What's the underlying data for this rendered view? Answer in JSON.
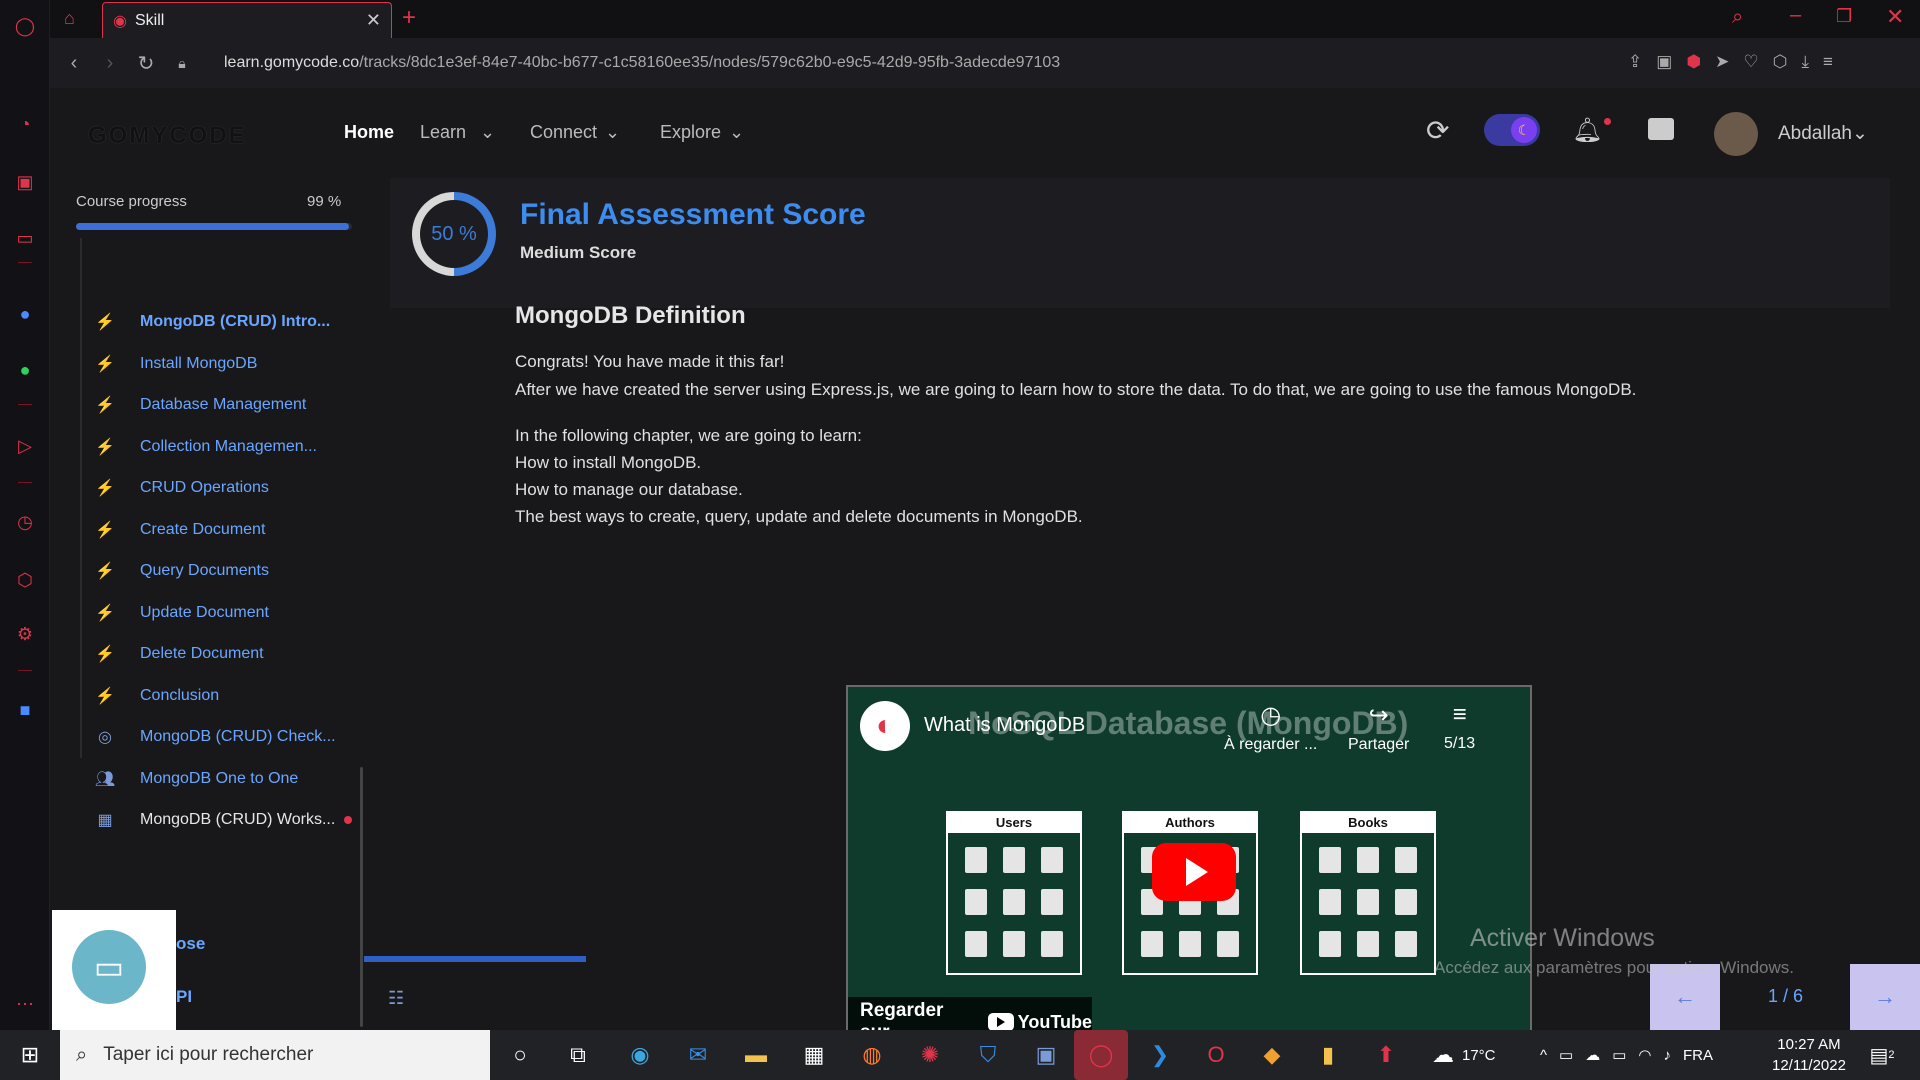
{
  "browser": {
    "tab_title": "Skill",
    "url_host": "learn.gomycode.co",
    "url_path": "/tracks/8dc1e3ef-84e7-40bc-b677-c1c58160ee35/nodes/579c62b0-e9c5-42d9-95fb-3adecde97103"
  },
  "header": {
    "logo": "GOMYCODE",
    "nav": [
      "Home",
      "Learn",
      "Connect",
      "Explore"
    ],
    "user_name": "Abdallah"
  },
  "sidebar": {
    "progress_label": "Course progress",
    "progress_pct": "99 %",
    "progress_value": 0.99,
    "lessons": [
      "MongoDB (CRUD) Intro...",
      "Install MongoDB",
      "Database Management",
      "Collection Managemen...",
      "CRUD Operations",
      "Create Document",
      "Query Documents",
      "Update Document",
      "Delete Document",
      "Conclusion",
      "MongoDB (CRUD) Check...",
      "MongoDB One to One",
      "MongoDB (CRUD) Works...",
      "ose",
      "PI"
    ]
  },
  "score": {
    "percent": "50 %",
    "value": 0.5,
    "title": "Final Assessment Score",
    "subtitle": "Medium Score"
  },
  "content": {
    "heading": "MongoDB Definition",
    "p1": "Congrats! You have made it this far!",
    "p2": "After we have created the server using Express.js, we are going to learn how to store the data. To do that, we are going to use the famous MongoDB.",
    "p3": "In the following chapter, we are going to learn:",
    "p4": "How to install MongoDB.",
    "p5": "How to manage our database.",
    "p6": "The best ways to create, query, update and delete documents in MongoDB."
  },
  "video": {
    "title": "What is MongoDB",
    "bg_title": "NoSQL Database (MongoDB)",
    "watch_later": "À regarder ...",
    "share": "Partager",
    "playlist": "5/13",
    "collections": [
      "Users",
      "Authors",
      "Books"
    ],
    "watch_on": "Regarder sur",
    "youtube": "YouTube"
  },
  "pager": {
    "page": "1 / 6"
  },
  "watermark": {
    "line1": "Activer Windows",
    "line2": "Accédez aux paramètres pour activer Windows."
  },
  "taskbar": {
    "search_placeholder": "Taper ici pour rechercher",
    "temperature": "17°C",
    "lang": "FRA",
    "time": "10:27 AM",
    "date": "12/11/2022",
    "notif_count": "2"
  },
  "colors": {
    "accent": "#3d8df0",
    "opera_red": "#e0344a",
    "bg": "#18181b"
  }
}
